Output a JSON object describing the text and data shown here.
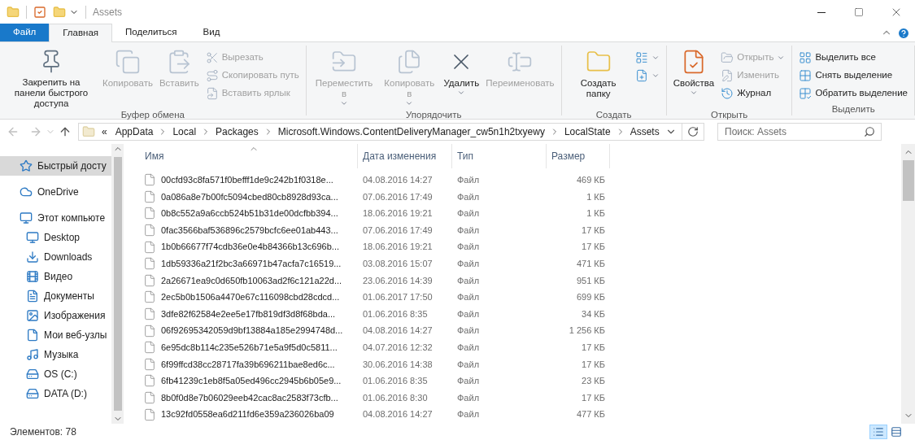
{
  "window": {
    "title": "Assets"
  },
  "tabs": [
    {
      "label": "Файл",
      "kind": "file",
      "selected": false
    },
    {
      "label": "Главная",
      "kind": "tab",
      "selected": true
    },
    {
      "label": "Поделиться",
      "kind": "tab",
      "selected": false
    },
    {
      "label": "Вид",
      "kind": "tab",
      "selected": false
    }
  ],
  "ribbon": {
    "groups": [
      {
        "label": "Буфер обмена",
        "items": [
          {
            "label": "Закрепить на панели быстрого доступа",
            "kind": "large",
            "disabled": false,
            "dropdown": false
          },
          {
            "label": "Копировать",
            "kind": "large",
            "disabled": true,
            "dropdown": false
          },
          {
            "label": "Вставить",
            "kind": "large",
            "disabled": true,
            "dropdown": false
          },
          {
            "label": "Вырезать",
            "kind": "small",
            "disabled": true,
            "dropdown": false
          },
          {
            "label": "Скопировать путь",
            "kind": "small",
            "disabled": true,
            "dropdown": false
          },
          {
            "label": "Вставить ярлык",
            "kind": "small",
            "disabled": true,
            "dropdown": false
          }
        ]
      },
      {
        "label": "Упорядочить",
        "items": [
          {
            "label": "Переместить в",
            "kind": "large",
            "disabled": true,
            "dropdown": true
          },
          {
            "label": "Копировать в",
            "kind": "large",
            "disabled": true,
            "dropdown": true
          },
          {
            "label": "Удалить",
            "kind": "large",
            "disabled": false,
            "dropdown": true
          },
          {
            "label": "Переименовать",
            "kind": "large",
            "disabled": true,
            "dropdown": false
          }
        ]
      },
      {
        "label": "Создать",
        "items": [
          {
            "label": "Создать папку",
            "kind": "large",
            "disabled": false,
            "dropdown": false
          },
          {
            "kind": "icon",
            "disabled": false,
            "dropdown": true
          },
          {
            "kind": "icon",
            "disabled": false,
            "dropdown": true
          }
        ]
      },
      {
        "label": "Открыть",
        "items": [
          {
            "label": "Свойства",
            "kind": "large",
            "disabled": false,
            "dropdown": true
          },
          {
            "label": "Открыть",
            "kind": "small",
            "disabled": true,
            "dropdown": true
          },
          {
            "label": "Изменить",
            "kind": "small",
            "disabled": true,
            "dropdown": false
          },
          {
            "label": "Журнал",
            "kind": "small",
            "disabled": false,
            "dropdown": false
          }
        ]
      },
      {
        "label": "Выделить",
        "items": [
          {
            "label": "Выделить все",
            "kind": "small",
            "disabled": false,
            "dropdown": false
          },
          {
            "label": "Снять выделение",
            "kind": "small",
            "disabled": false,
            "dropdown": false
          },
          {
            "label": "Обратить выделение",
            "kind": "small",
            "disabled": false,
            "dropdown": false
          }
        ]
      }
    ]
  },
  "address_bar": {
    "overflow": "«",
    "path": [
      "AppData",
      "Local",
      "Packages",
      "Microsoft.Windows.ContentDeliveryManager_cw5n1h2txyewy",
      "LocalState",
      "Assets"
    ]
  },
  "search": {
    "placeholder": "Поиск: Assets"
  },
  "sidebar": {
    "items": [
      {
        "label": "Быстрый досту",
        "selected": true
      },
      {
        "label": "OneDrive",
        "selected": false
      },
      {
        "label": "Этот компьюте",
        "selected": false,
        "children": [
          {
            "label": "Desktop",
            "selected": false
          },
          {
            "label": "Downloads",
            "selected": false
          },
          {
            "label": "Видео",
            "selected": false
          },
          {
            "label": "Документы",
            "selected": false
          },
          {
            "label": "Изображения",
            "selected": false
          },
          {
            "label": "Мои веб-узлы",
            "selected": false
          },
          {
            "label": "Музыка",
            "selected": false
          },
          {
            "label": "OS (C:)",
            "selected": false
          },
          {
            "label": "DATA (D:)",
            "selected": false
          }
        ]
      }
    ]
  },
  "table": {
    "columns": [
      {
        "label": "Имя",
        "sorted": true
      },
      {
        "label": "Дата изменения",
        "sorted": false
      },
      {
        "label": "Тип",
        "sorted": false
      },
      {
        "label": "Размер",
        "sorted": false
      }
    ],
    "rows": [
      [
        "00cfd93c8fa571f0befff1de9c242b1f0318e...",
        "04.08.2016 14:27",
        "Файл",
        "469 КБ"
      ],
      [
        "0a086a8e7b00fc5094cbed80cb8928d93ca...",
        "07.06.2016 17:49",
        "Файл",
        "1 КБ"
      ],
      [
        "0b8c552a9a6ccb524b51b31de00dcfbb394...",
        "18.06.2016 19:21",
        "Файл",
        "1 КБ"
      ],
      [
        "0fac3566baf536896c2579bcfc6ee01ab443...",
        "07.06.2016 17:49",
        "Файл",
        "17 КБ"
      ],
      [
        "1b0b66677f74cdb36e0e4b84366b13c696b...",
        "18.06.2016 19:21",
        "Файл",
        "17 КБ"
      ],
      [
        "1db59336a21f2bc3a66971b47acfa7c16519...",
        "03.08.2016 15:07",
        "Файл",
        "471 КБ"
      ],
      [
        "2a26671ea9c0d650fb10063ad2f6c121a22d...",
        "23.06.2016 14:39",
        "Файл",
        "951 КБ"
      ],
      [
        "2ec5b0b1506a4470e67c116098cbd28cdcd...",
        "01.06.2017 17:50",
        "Файл",
        "699 КБ"
      ],
      [
        "3dfe82f62584e2ee5e17fb819df3d8f68bda...",
        "01.06.2016 8:35",
        "Файл",
        "34 КБ"
      ],
      [
        "06f92695342059d9bf13884a185e2994748d...",
        "04.08.2016 14:27",
        "Файл",
        "1 256 КБ"
      ],
      [
        "6e95dc8b114c235e526b71e5a9f5d0c5811...",
        "04.07.2016 12:32",
        "Файл",
        "17 КБ"
      ],
      [
        "6f99ffcd38cc28717fa39b696211bae8ed6c...",
        "30.06.2016 14:38",
        "Файл",
        "17 КБ"
      ],
      [
        "6fb41239c1eb8f5a05ed496cc2945b6b05e9...",
        "01.06.2016 8:35",
        "Файл",
        "23 КБ"
      ],
      [
        "8b0f0d8e7b06029eeb42cac8ac2583f73cfb...",
        "01.06.2016 8:30",
        "Файл",
        "17 КБ"
      ],
      [
        "13c92fd0558ea6d211fd6e359a236026ba09",
        "04.08.2016 14:27",
        "Файл",
        "477 КБ"
      ]
    ]
  },
  "status_bar": {
    "text": "Элементов: 78",
    "views": [
      {
        "kind": "details",
        "selected": true
      },
      {
        "kind": "large_icons",
        "selected": false
      }
    ]
  }
}
